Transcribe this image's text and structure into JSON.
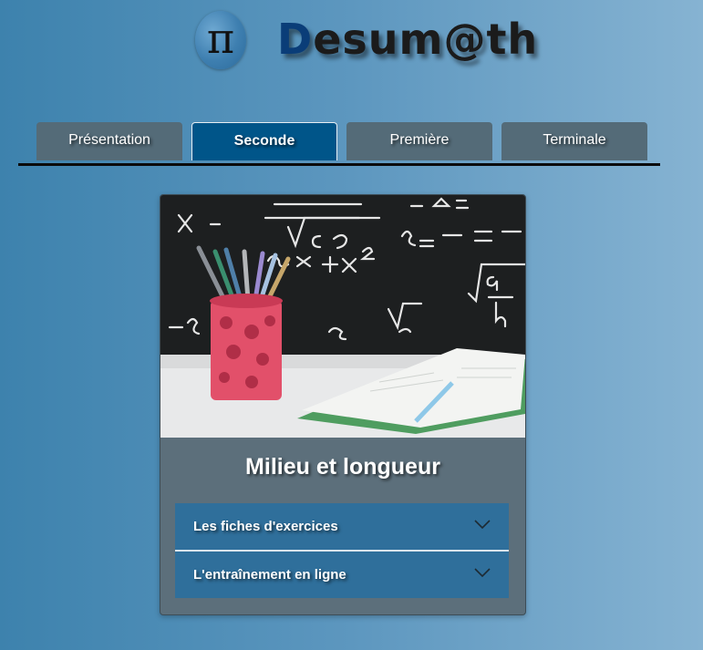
{
  "header": {
    "logo_symbol": "π",
    "brand_first_letter": "D",
    "brand_rest": "esum@th"
  },
  "tabs": [
    {
      "label": "Présentation",
      "active": false
    },
    {
      "label": "Seconde",
      "active": true
    },
    {
      "label": "Première",
      "active": false
    },
    {
      "label": "Terminale",
      "active": false
    }
  ],
  "card": {
    "title": "Milieu et longueur",
    "accordion": [
      {
        "label": "Les fiches d'exercices",
        "icon": "chevron-down-icon"
      },
      {
        "label": "L'entraînement en ligne",
        "icon": "chevron-down-icon"
      }
    ]
  },
  "colors": {
    "tab_inactive": "#546b78",
    "tab_active": "#005589",
    "card_bg": "#5c6f7b",
    "accordion_bg": "#2f6f9b"
  }
}
